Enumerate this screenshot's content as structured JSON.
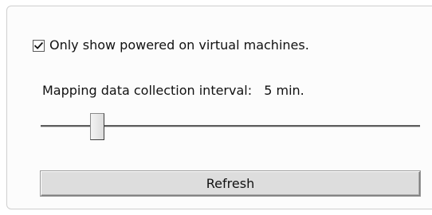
{
  "filters": {
    "powered_on_only": {
      "label": "Only show powered on virtual machines.",
      "checked": true
    }
  },
  "mapping": {
    "interval_label": "Mapping data collection interval:",
    "interval_value": "5 min."
  },
  "actions": {
    "refresh_label": "Refresh"
  },
  "icons": {
    "checkmark": "checkmark-icon"
  },
  "colors": {
    "panel_border": "#cfcfcf",
    "button_face": "#dddddd",
    "text": "#111111"
  }
}
